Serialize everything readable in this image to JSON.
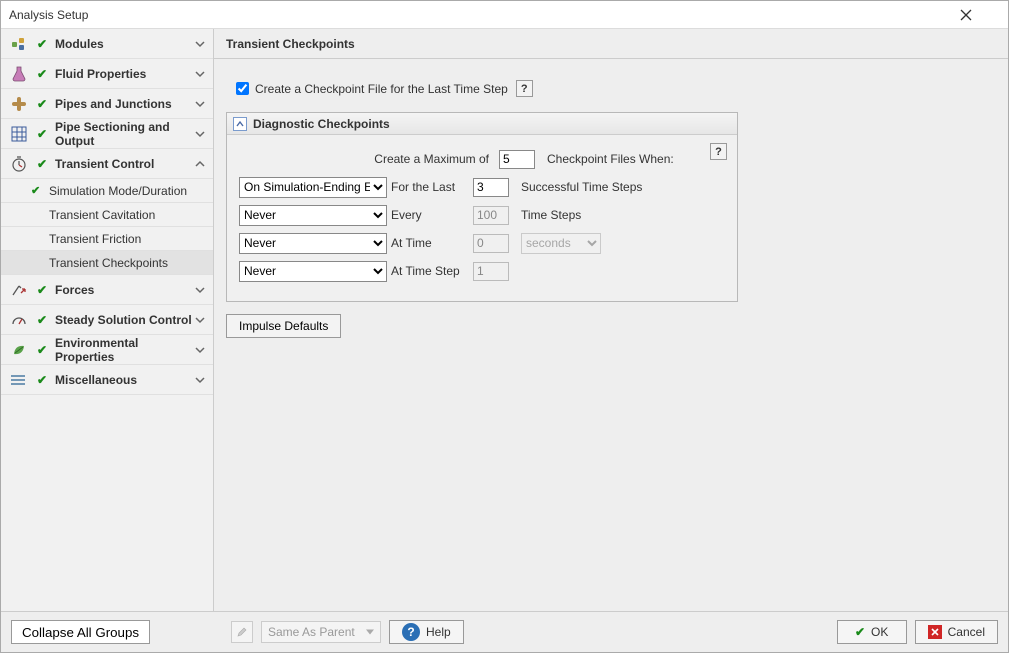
{
  "window": {
    "title": "Analysis Setup"
  },
  "sidebar": {
    "groups": [
      {
        "label": "Modules"
      },
      {
        "label": "Fluid Properties"
      },
      {
        "label": "Pipes and Junctions"
      },
      {
        "label": "Pipe Sectioning and Output"
      },
      {
        "label": "Transient Control",
        "expanded": true
      },
      {
        "label": "Forces"
      },
      {
        "label": "Steady Solution Control"
      },
      {
        "label": "Environmental Properties"
      },
      {
        "label": "Miscellaneous"
      }
    ],
    "transient_children": [
      {
        "label": "Simulation Mode/Duration",
        "checked": true
      },
      {
        "label": "Transient Cavitation"
      },
      {
        "label": "Transient Friction"
      },
      {
        "label": "Transient Checkpoints",
        "selected": true
      }
    ]
  },
  "main": {
    "header": "Transient Checkpoints",
    "checkbox_label": "Create a Checkpoint File for the Last Time Step",
    "checkbox_checked": true,
    "panel_title": "Diagnostic Checkpoints",
    "row0": {
      "label": "Create a Maximum of",
      "value": "5",
      "suffix": "Checkpoint Files When:"
    },
    "rows": [
      {
        "dropdown": "On Simulation-Ending Error",
        "label": "For the Last",
        "value": "3",
        "suffix": "Successful Time Steps",
        "disabled": false
      },
      {
        "dropdown": "Never",
        "label": "Every",
        "value": "100",
        "suffix": "Time Steps",
        "disabled": true
      },
      {
        "dropdown": "Never",
        "label": "At Time",
        "value": "0",
        "suffix_unit": "seconds",
        "disabled": true
      },
      {
        "dropdown": "Never",
        "label": "At Time Step",
        "value": "1",
        "suffix": "",
        "disabled": true
      }
    ],
    "impulse_defaults": "Impulse Defaults"
  },
  "footer": {
    "collapse_all": "Collapse All Groups",
    "same_as_parent": "Same As Parent",
    "help": "Help",
    "ok": "OK",
    "cancel": "Cancel"
  }
}
